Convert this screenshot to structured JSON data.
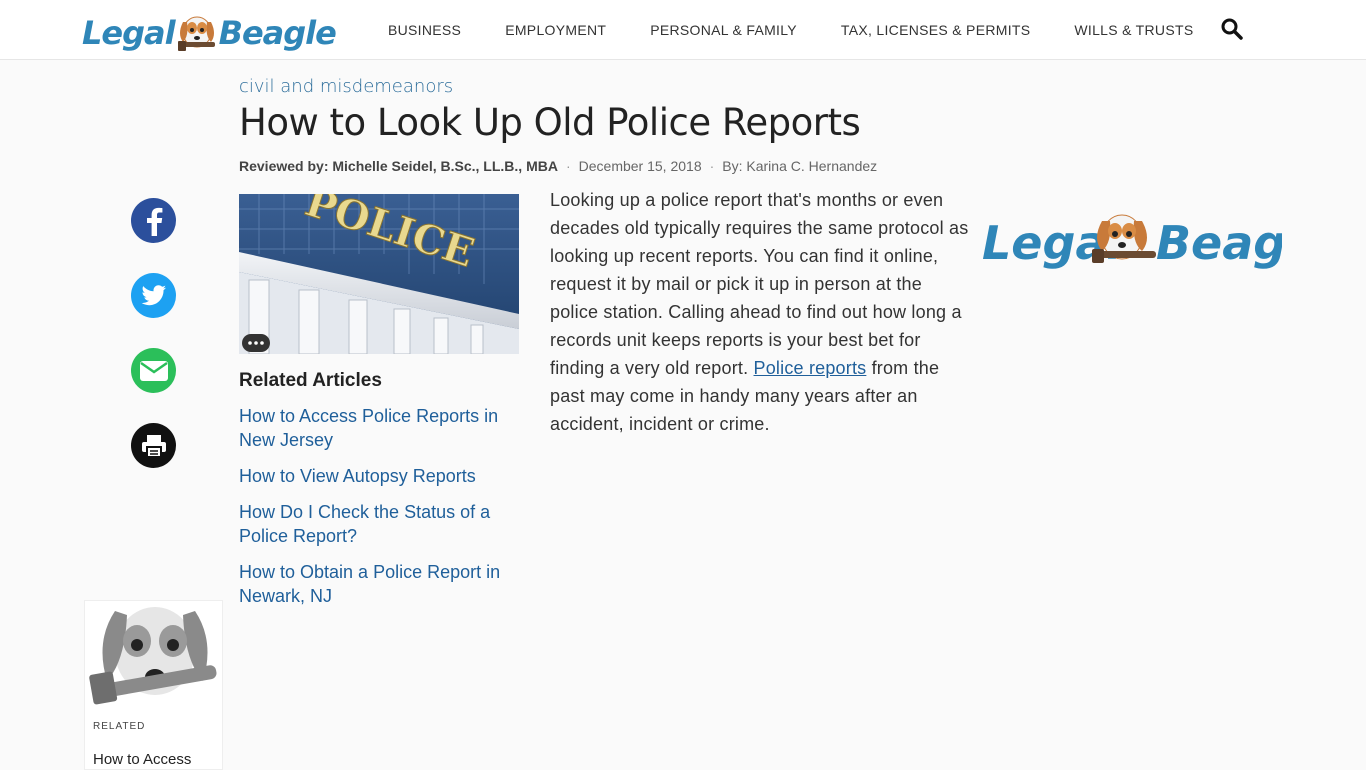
{
  "brand": {
    "name": "LegalBeagle",
    "logo_left": "Legal",
    "logo_right": "Beagle",
    "color": "#2f86b8"
  },
  "nav": {
    "items": [
      "BUSINESS",
      "EMPLOYMENT",
      "PERSONAL & FAMILY",
      "TAX, LICENSES & PERMITS",
      "WILLS & TRUSTS"
    ],
    "search_icon": "search-icon"
  },
  "article": {
    "category": "civil and misdemeanors",
    "title": "How to Look Up Old Police Reports",
    "reviewed_by": "Reviewed by: Michelle Seidel, B.Sc., LL.B., MBA",
    "date": "December 15, 2018",
    "author": "By: Karina C. Hernandez",
    "body_before_link": "Looking up a police report that's months or even decades old typically requires the same protocol as looking up recent reports. You can find it online, request it by mail or pick it up in person at the police station. Calling ahead to find out how long a records unit keeps reports is your best bet for finding a very old report. ",
    "link_text": "Police reports",
    "body_after_link": " from the past may come in handy many years after an accident, incident or crime.",
    "hero_sign": "POLICE"
  },
  "social": [
    "facebook-icon",
    "twitter-icon",
    "email-icon",
    "print-icon"
  ],
  "related": {
    "heading": "Related Articles",
    "items": [
      "How to Access Police Reports in New Jersey",
      "How to View Autopsy Reports",
      "How Do I Check the Status of a Police Report?",
      "How to Obtain a Police Report in Newark, NJ"
    ]
  },
  "related_card": {
    "label": "RELATED",
    "title": "How to Access"
  }
}
